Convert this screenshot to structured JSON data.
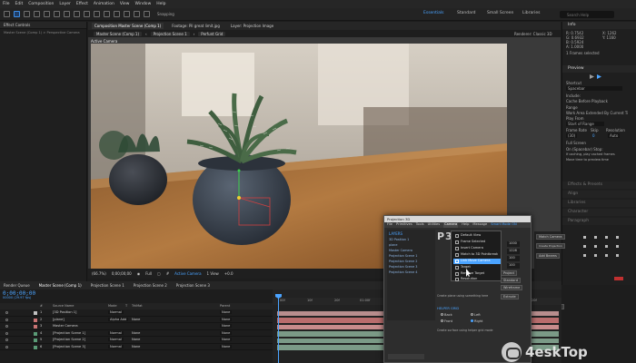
{
  "menubar": [
    "File",
    "Edit",
    "Composition",
    "Layer",
    "Effect",
    "Animation",
    "View",
    "Window",
    "Help"
  ],
  "toolbar": {
    "snapping_label": "Snapping",
    "workspaces": [
      "Essentials",
      "Standard",
      "Small Screen",
      "Libraries"
    ],
    "active_workspace": "Essentials",
    "search_placeholder": "Search Help"
  },
  "left_panel": {
    "tab": "Effect Controls",
    "tab_sub": "Master Scene (Comp 1) > Perspective Camera"
  },
  "comp_tabs": [
    "Composition Master Scene (Comp 1)",
    "Footage: Pil great limit.jpg",
    "Layer: Projection Image"
  ],
  "comp_subtabs": [
    "Master Scene (Comp 1)",
    "Projection Scene 1",
    "Perfunt Grid"
  ],
  "renderer_label": "Renderer: Classic 3D",
  "viewer": {
    "active_camera_label": "Active Camera",
    "footer": {
      "zoom": "(66.7%)",
      "time": "0;00;00;00",
      "resolution": "Full",
      "view_dropdown": "Active Camera",
      "views": "1 View",
      "offset": "+0.0"
    }
  },
  "right_panel": {
    "info_header": "Info",
    "info_lines": [
      "R: 0.7542",
      "G: 0.6932",
      "B: 0.5924",
      "A: 1.0000"
    ],
    "info_coords": [
      "X: 1262",
      "Y: 1160"
    ],
    "frames_selected": "1 Frames selected",
    "preview_header": "Preview",
    "shortcut_label": "Shortcut",
    "shortcut_value": "Spacebar",
    "include_label": "Include:",
    "cache_before": "Cache Before Playback",
    "range_label": "Range",
    "range_value": "Work Area Extended By Current Ti",
    "play_from_label": "Play From",
    "play_from_value": "Start of Range",
    "frame_rate_label": "Frame Rate",
    "skip_label": "Skip",
    "resolution_label": "Resolution",
    "frame_rate_value": "(30)",
    "skip_value": "0",
    "resolution_value": "Auto",
    "full_screen": "Full Screen",
    "on_stop_label": "On (Spacebar) Stop:",
    "if_caching": "If caching, play cached frames",
    "move_time": "Move time to preview time",
    "sections": [
      "Effects & Presets",
      "Align",
      "Libraries",
      "Character",
      "Paragraph"
    ],
    "p3d_buttons": [
      "Match Camera",
      "Create Projection",
      "Add Beams"
    ],
    "p3d_labels": [
      "Projection Image",
      "Group: (Null)"
    ]
  },
  "timeline": {
    "tabs": [
      "Render Queue",
      "Master Scene (Comp 1)",
      "Projection Scene 1",
      "Projection Scene 2",
      "Projection Scene 3"
    ],
    "timecode": "0;00;00;00",
    "fps": "00000 (29.97 fps)",
    "columns": [
      "#",
      "Source Name",
      "Mode",
      "T",
      "TrkMat",
      "Parent"
    ],
    "ruler": [
      "00f",
      "10f",
      "20f",
      "01:00f",
      "10f",
      "20f",
      "02:00f",
      "10f",
      "20f"
    ],
    "layers": [
      {
        "num": "1",
        "name": "[3D Position 1]",
        "mode": "Normal",
        "trkmat": "",
        "parent": "None",
        "color": "#c0c0c0",
        "bar": "#b88d8d"
      },
      {
        "num": "2",
        "name": "[plane]",
        "mode": "Alpha Add",
        "trkmat": "None",
        "parent": "None",
        "color": "#c97373",
        "bar": "#b96d6d"
      },
      {
        "num": "3",
        "name": "Master Camera",
        "mode": "",
        "trkmat": "",
        "parent": "None",
        "color": "#c97373",
        "bar": "#c78c8c"
      },
      {
        "num": "4",
        "name": "[Projection Scene 1]",
        "mode": "Normal",
        "trkmat": "None",
        "parent": "None",
        "color": "#5a9b76",
        "bar": "#7b9a87"
      },
      {
        "num": "5",
        "name": "[Projection Scene 2]",
        "mode": "Normal",
        "trkmat": "None",
        "parent": "None",
        "color": "#5a9b76",
        "bar": "#7b9a87"
      },
      {
        "num": "6",
        "name": "[Projection Scene 3]",
        "mode": "Normal",
        "trkmat": "None",
        "parent": "None",
        "color": "#5a9b76",
        "bar": "#7b9a87"
      }
    ]
  },
  "dialog": {
    "title": "Projection 3D",
    "menu": [
      "File",
      "Primitives",
      "Tools",
      "Utilities",
      "Camera",
      "Help",
      "Message"
    ],
    "menu_highlight": "Camera",
    "menu_message": "Smart Mode ON",
    "layers_header": "LAYERS",
    "layers": [
      "3D Position 1",
      "plane",
      "Master Camera",
      "Projection Scene 1",
      "Projection Scene 2",
      "Projection Scene 3",
      "Projection Scene 4"
    ],
    "logo": "P3D",
    "dropdown": [
      "Default View",
      "Frame Selected",
      "Insert Camera",
      "Match to 3D Pointbreak",
      "Link Move Camera",
      "Target",
      "Remove Target",
      "Resolution"
    ],
    "dropdown_highlight": "Link Move Camera",
    "fields": [
      "1000",
      "1228",
      "100",
      "100"
    ],
    "buttons": [
      "Project",
      "Standard",
      "Wireframe",
      "Extrude"
    ],
    "status": "Create plane using something here",
    "helper_header": "HELPER GRID",
    "helper_options": [
      "Back",
      "Left",
      "Front",
      "Right"
    ],
    "helper_note": "Create surface using helper grid mode"
  },
  "watermark": "4eskTop"
}
